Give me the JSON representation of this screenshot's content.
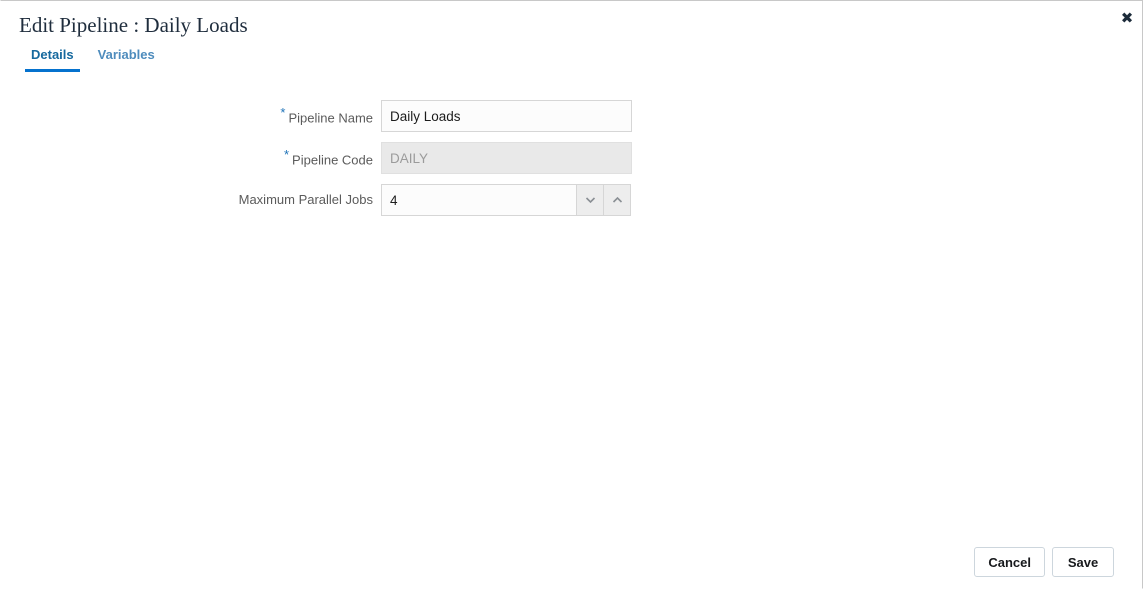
{
  "dialog": {
    "title": "Edit Pipeline : Daily Loads",
    "close_label": "✖"
  },
  "tabs": [
    {
      "label": "Details",
      "active": true
    },
    {
      "label": "Variables",
      "active": false
    }
  ],
  "form": {
    "required_marker": "*",
    "fields": [
      {
        "label": "Pipeline Name",
        "value": "Daily Loads",
        "placeholder": "",
        "required": true,
        "disabled": false,
        "type": "text"
      },
      {
        "label": "Pipeline Code",
        "value": "DAILY",
        "placeholder": "",
        "required": true,
        "disabled": true,
        "type": "text"
      },
      {
        "label": "Maximum Parallel Jobs",
        "value": "4",
        "placeholder": "",
        "required": false,
        "disabled": false,
        "type": "spinner"
      }
    ]
  },
  "footer": {
    "cancel_label": "Cancel",
    "save_label": "Save"
  },
  "colors": {
    "accent": "#0572ce",
    "tab_active": "#16699e",
    "tab_inactive": "#4e8cbd",
    "required_star": "#1d72b8",
    "label": "#5b5b5b",
    "disabled_bg": "#e9e9e9"
  }
}
